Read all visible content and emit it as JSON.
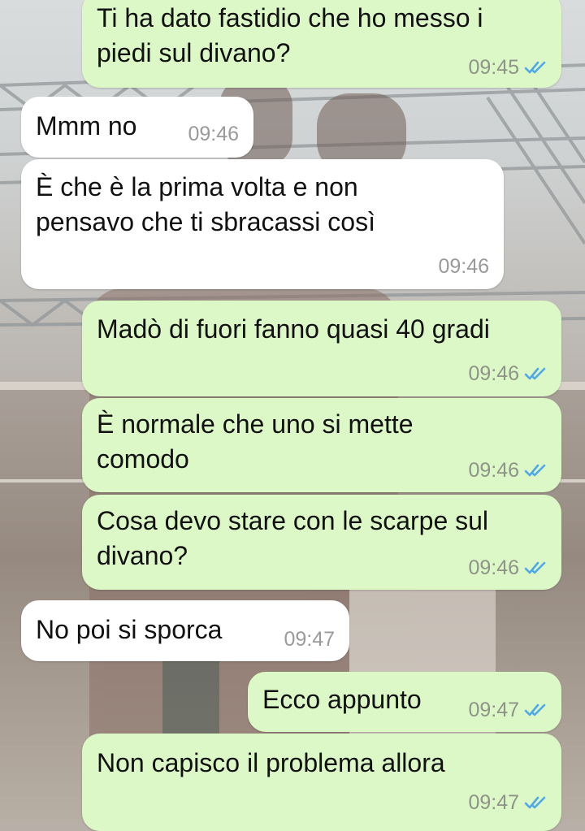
{
  "colors": {
    "outgoing_bubble": "#dcf8c6",
    "incoming_bubble": "#ffffff",
    "read_ticks": "#4fa8e8",
    "timestamp": "#8e9489"
  },
  "icons": {
    "read_receipt": "double-check-icon"
  },
  "messages": [
    {
      "direction": "outgoing",
      "lines": [
        "Ti ha dato fastidio che ho messo i",
        "piedi sul divano?"
      ],
      "time": "09:45",
      "read": true
    },
    {
      "direction": "incoming",
      "lines": [
        "Mmm no"
      ],
      "time": "09:46"
    },
    {
      "direction": "incoming",
      "lines": [
        "È che è la prima volta e non",
        "pensavo che ti sbracassi così"
      ],
      "time": "09:46"
    },
    {
      "direction": "outgoing",
      "lines": [
        "Madò di fuori fanno quasi 40 gradi"
      ],
      "time": "09:46",
      "read": true
    },
    {
      "direction": "outgoing",
      "lines": [
        "È normale che uno si mette",
        "comodo"
      ],
      "time": "09:46",
      "read": true
    },
    {
      "direction": "outgoing",
      "lines": [
        "Cosa devo stare con le scarpe sul",
        "divano?"
      ],
      "time": "09:46",
      "read": true
    },
    {
      "direction": "incoming",
      "lines": [
        "No poi si sporca"
      ],
      "time": "09:47"
    },
    {
      "direction": "outgoing",
      "lines": [
        "Ecco appunto"
      ],
      "time": "09:47",
      "read": true
    },
    {
      "direction": "outgoing",
      "lines": [
        "Non capisco il problema allora"
      ],
      "time": "09:47",
      "read": true
    }
  ]
}
